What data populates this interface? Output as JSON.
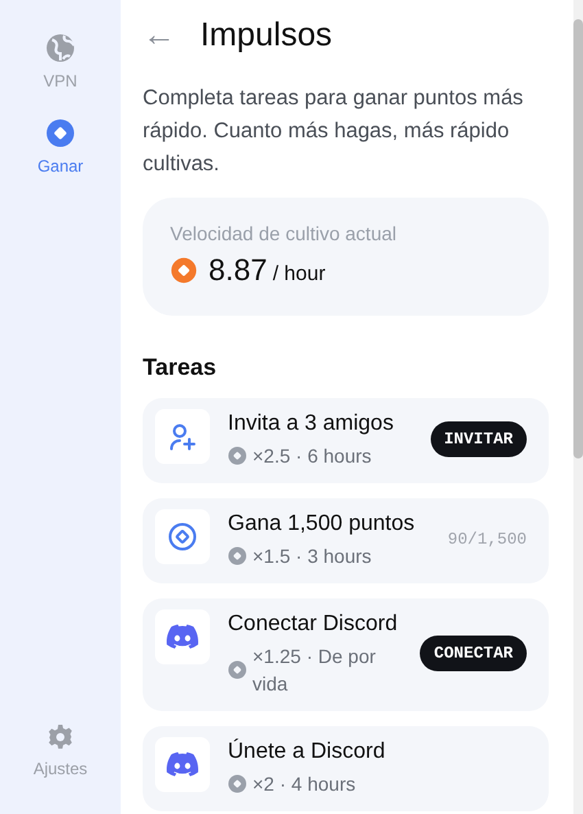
{
  "sidebar": {
    "items": [
      {
        "label": "VPN",
        "selected": false
      },
      {
        "label": "Ganar",
        "selected": true
      }
    ],
    "footer": {
      "label": "Ajustes",
      "selected": false
    }
  },
  "header": {
    "back": "←",
    "title": "Impulsos"
  },
  "description": "Completa tareas para ganar puntos más rápido. Cuanto más hagas, más rápido cultivas.",
  "rate_card": {
    "label": "Velocidad de cultivo actual",
    "value": "8.87",
    "unit": "/ hour"
  },
  "tasks_heading": "Tareas",
  "tasks": [
    {
      "title": "Invita a 3 amigos",
      "boost": "×2.5 · 6 hours",
      "kind": "button",
      "action": "INVITAR"
    },
    {
      "title": "Gana 1,500 puntos",
      "boost": "×1.5 · 3 hours",
      "kind": "progress",
      "progress": "90/1,500"
    },
    {
      "title": "Conectar Discord",
      "boost": "×1.25 · De por vida",
      "kind": "button",
      "action": "CONECTAR"
    },
    {
      "title": "Únete a Discord",
      "boost": "×2 · 4 hours",
      "kind": "none"
    }
  ]
}
